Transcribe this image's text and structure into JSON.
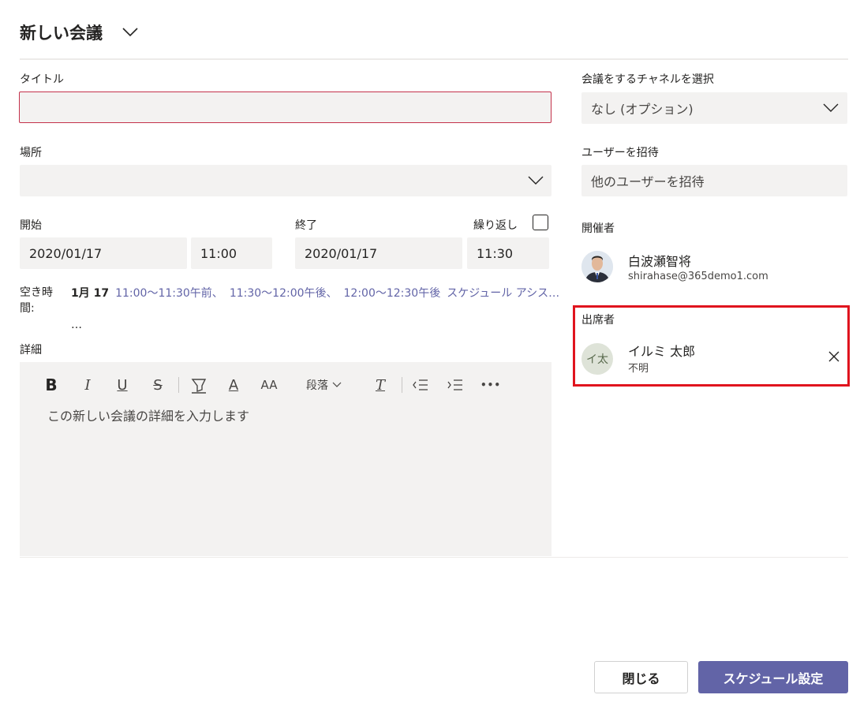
{
  "header": {
    "title": "新しい会議"
  },
  "form": {
    "title_label": "タイトル",
    "title_value": "",
    "location_label": "場所",
    "location_value": "",
    "start_label": "開始",
    "start_date": "2020/01/17",
    "start_time": "11:00",
    "end_label": "終了",
    "end_date": "2020/01/17",
    "end_time": "11:30",
    "repeat_label": "繰り返し",
    "free_time_label_1": "空き時",
    "free_time_label_2": "間:",
    "free_time_date": "1月 17",
    "free_slots": [
      "11:00～11:30午前、",
      "11:30～12:00午後、",
      "12:00～12:30午後"
    ],
    "schedule_assistant": "スケジュール アシス…",
    "free_more": "…",
    "details_label": "詳細",
    "details_placeholder": "この新しい会議の詳細を入力します"
  },
  "toolbar": {
    "bold": "B",
    "italic": "I",
    "underline": "U",
    "strike": "S",
    "font_color": "A",
    "font_size": "AA",
    "paragraph": "段落",
    "clear_format": "T",
    "more": "•••"
  },
  "side": {
    "channel_label": "会議をするチャネルを選択",
    "channel_value": "なし (オプション)",
    "invite_label": "ユーザーを招待",
    "invite_placeholder": "他のユーザーを招待",
    "organizer_label": "開催者",
    "organizer_name": "白波瀬智将",
    "organizer_email": "shirahase@365demo1.com",
    "attendees_label": "出席者",
    "attendee_initials": "イ太",
    "attendee_name": "イルミ 太郎",
    "attendee_status": "不明"
  },
  "footer": {
    "close_label": "閉じる",
    "schedule_label": "スケジュール設定"
  },
  "colors": {
    "accent": "#6264a7",
    "highlight": "#e0141e",
    "field_bg": "#f3f2f1"
  }
}
